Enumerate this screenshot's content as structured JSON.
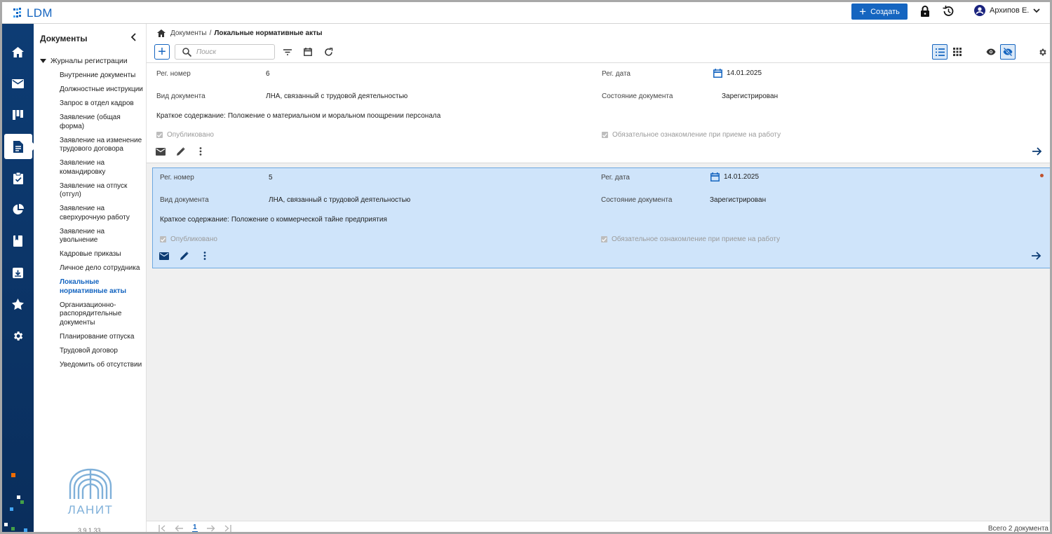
{
  "app": {
    "logo": "LDM"
  },
  "topbar": {
    "create_label": "Создать",
    "user_name": "Архипов Е."
  },
  "sidebar": {
    "title": "Документы",
    "tree_root": "Журналы регистрации",
    "items": [
      {
        "label": "Внутренние документы"
      },
      {
        "label": "Должностные инструкции"
      },
      {
        "label": "Запрос в отдел кадров"
      },
      {
        "label": "Заявление (общая форма)"
      },
      {
        "label": "Заявление на изменение трудового договора"
      },
      {
        "label": "Заявление на командировку"
      },
      {
        "label": "Заявление на отпуск (отгул)"
      },
      {
        "label": "Заявление на сверхурочную работу"
      },
      {
        "label": "Заявление на увольнение"
      },
      {
        "label": "Кадровые приказы"
      },
      {
        "label": "Личное дело сотрудника"
      },
      {
        "label": "Локальные нормативные акты"
      },
      {
        "label": "Организационно-распорядительные документы"
      },
      {
        "label": "Планирование отпуска"
      },
      {
        "label": "Трудовой договор"
      },
      {
        "label": "Уведомить об отсутствии"
      }
    ],
    "brand": "ЛАНИТ",
    "version": "3.9.1.33"
  },
  "breadcrumb": {
    "root": "Документы",
    "separator": "/",
    "current": "Локальные нормативные акты"
  },
  "search": {
    "placeholder": "Поиск"
  },
  "labels": {
    "reg_number": "Рег. номер",
    "reg_date": "Рег. дата",
    "doc_type": "Вид документа",
    "doc_state": "Состояние документа",
    "summary": "Краткое содержание:",
    "published": "Опубликовано",
    "mandatory": "Обязательное ознакомление при приеме на работу"
  },
  "documents": [
    {
      "reg_number": "6",
      "reg_date": "14.01.2025",
      "doc_type": "ЛНА, связанный с трудовой деятельностью",
      "doc_state": "Зарегистрирован",
      "summary": "Положение о материальном и моральном поощрении персонала",
      "selected": false
    },
    {
      "reg_number": "5",
      "reg_date": "14.01.2025",
      "doc_type": "ЛНА, связанный с трудовой деятельностью",
      "doc_state": "Зарегистрирован",
      "summary": "Положение о коммерческой тайне предприятия",
      "selected": true
    }
  ],
  "pagination": {
    "current_page": "1",
    "total_text": "Всего 2 документа"
  },
  "colors": {
    "accent": "#1565c0",
    "nav_bg": "#0d3c74",
    "selected_bg": "#cfe4fa"
  }
}
